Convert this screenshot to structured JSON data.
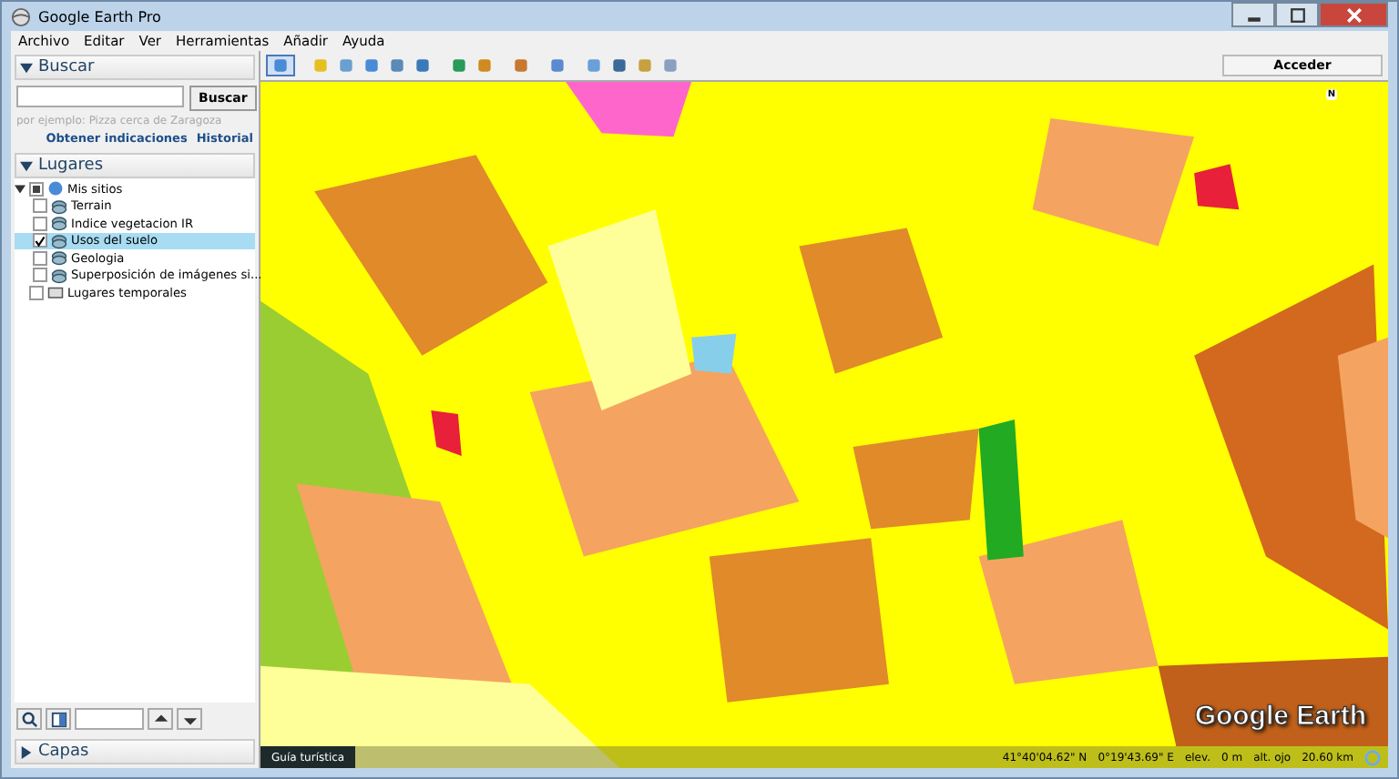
{
  "window": {
    "title": "Google Earth Pro"
  },
  "menu": [
    "Archivo",
    "Editar",
    "Ver",
    "Herramientas",
    "Añadir",
    "Ayuda"
  ],
  "search": {
    "title": "Buscar",
    "button": "Buscar",
    "hint": "por ejemplo: Pizza cerca de Zaragoza",
    "links": [
      "Obtener indicaciones",
      "Historial"
    ]
  },
  "places": {
    "title": "Lugares",
    "tree": [
      {
        "label": "Mis sitios",
        "kind": "folder",
        "checked": true,
        "partial": true,
        "expanded": true,
        "selected": false,
        "children": [
          {
            "label": "Terrain",
            "kind": "layer",
            "checked": false,
            "selected": false
          },
          {
            "label": "Indice vegetacion IR",
            "kind": "layer",
            "checked": false,
            "selected": false
          },
          {
            "label": "Usos del suelo",
            "kind": "layer",
            "checked": true,
            "selected": true
          },
          {
            "label": "Geologia",
            "kind": "layer",
            "checked": false,
            "selected": false
          },
          {
            "label": "Superposición de imágenes si...",
            "kind": "layer",
            "checked": false,
            "selected": false
          }
        ]
      },
      {
        "label": "Lugares temporales",
        "kind": "box",
        "checked": false,
        "selected": false
      }
    ]
  },
  "layers": {
    "title": "Capas"
  },
  "toolbar": {
    "sign_in": "Acceder"
  },
  "map": {
    "compass": "N",
    "logo": "Google Earth",
    "tour": "Guía turística",
    "status": [
      "41°40'04.62\" N",
      "0°19'43.69\" E",
      "elev.",
      "0 m",
      "alt. ojo",
      "20.60 km"
    ]
  }
}
